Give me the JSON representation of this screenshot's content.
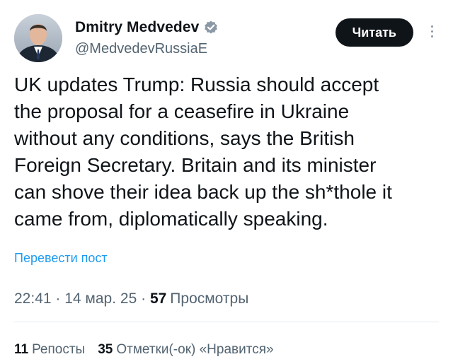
{
  "author": {
    "display_name": "Dmitry Medvedev",
    "handle": "@MedvedevRussiaE",
    "verified_icon": "verified-badge-icon",
    "verified_color": "#8b98a5"
  },
  "actions": {
    "follow_label": "Читать"
  },
  "tweet": {
    "text": "UK updates Trump: Russia should accept\nthe proposal for a ceasefire in Ukraine\nwithout any conditions, says the British\nForeign Secretary. Britain and its minister\ncan shove their idea back up the sh*thole it\ncame from, diplomatically speaking.",
    "translate_label": "Перевести пост"
  },
  "meta": {
    "time": "22:41",
    "separator": " · ",
    "date": "14 мар. 25",
    "views_count": "57",
    "views_label": "Просмотры"
  },
  "stats": {
    "reposts_count": "11",
    "reposts_label": "Репосты",
    "likes_count": "35",
    "likes_label": "Отметки(-ок) «Нравится»"
  },
  "colors": {
    "text": "#0f1419",
    "secondary": "#536471",
    "link": "#1d9bf0",
    "button_bg": "#0f1419",
    "button_text": "#ffffff"
  }
}
